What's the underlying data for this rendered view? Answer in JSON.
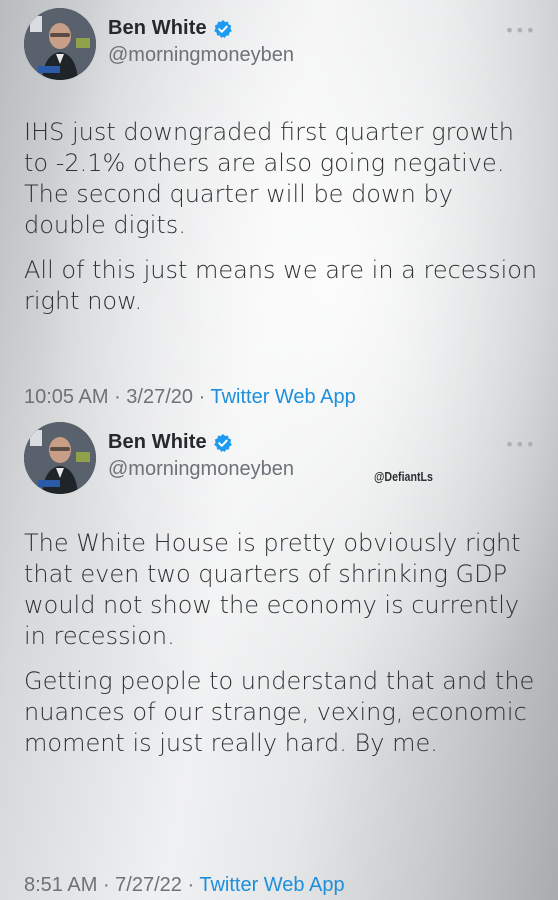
{
  "tweets": [
    {
      "author": {
        "name": "Ben White",
        "handle": "@morningmoneyben",
        "verified": true,
        "avatar_badge": "POLITICO"
      },
      "more_icon": "ellipsis-icon",
      "paragraphs": [
        "IHS just downgraded first quarter growth to -2.1% others are also going negative. The second quarter will be down by double digits.",
        "All of this just means we are in a recession right now."
      ],
      "time": "10:05 AM",
      "date": "3/27/20",
      "source": "Twitter Web App"
    },
    {
      "author": {
        "name": "Ben White",
        "handle": "@morningmoneyben",
        "verified": true,
        "avatar_badge": "POLITICO"
      },
      "more_icon": "ellipsis-icon",
      "paragraphs": [
        "The White House is pretty obviously right that even two quarters of shrinking GDP would not show the economy is currently in recession.",
        "Getting people to understand that and the nuances of our strange, vexing, economic moment is just really hard. By me."
      ],
      "time": "8:51 AM",
      "date": "7/27/22",
      "source": "Twitter Web App"
    }
  ],
  "watermark": "@DefiantLs",
  "colors": {
    "link": "#1d8fdc",
    "verified": "#1d9bf0",
    "muted": "#6c7277",
    "text": "#2f3133"
  }
}
